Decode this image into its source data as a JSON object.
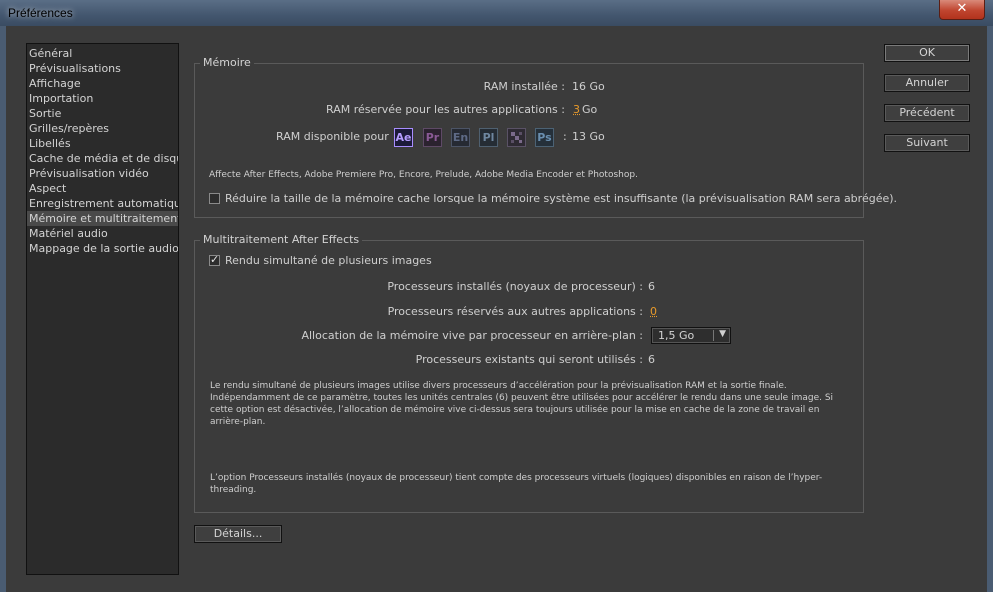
{
  "window": {
    "title": "Préférences",
    "close_symbol": "✕"
  },
  "sidebar": {
    "items": [
      {
        "label": "Général"
      },
      {
        "label": "Prévisualisations"
      },
      {
        "label": "Affichage"
      },
      {
        "label": "Importation"
      },
      {
        "label": "Sortie"
      },
      {
        "label": "Grilles/repères"
      },
      {
        "label": "Libellés"
      },
      {
        "label": "Cache de média et de disque"
      },
      {
        "label": "Prévisualisation vidéo"
      },
      {
        "label": "Aspect"
      },
      {
        "label": "Enregistrement automatique"
      },
      {
        "label": "Mémoire et multitraitement"
      },
      {
        "label": "Matériel audio"
      },
      {
        "label": "Mappage de la sortie audio"
      }
    ],
    "selected": "Mémoire et multitraitement"
  },
  "memory": {
    "legend": "Mémoire",
    "installed_label": "RAM installée :",
    "installed_value": "16 Go",
    "reserved_label": "RAM réservée pour les autres applications :",
    "reserved_value": "3",
    "reserved_unit": "Go",
    "available_label": "RAM disponible pour",
    "available_sep": ":",
    "available_value": "13 Go",
    "apps": [
      {
        "icon": "after-effects-icon",
        "text": "Ae",
        "color": "#b59cff",
        "bg": "#1c1a3a",
        "border": "#a88dff"
      },
      {
        "icon": "premiere-pro-icon",
        "text": "Pr",
        "color": "#8a5a96",
        "bg": "#2b222f",
        "border": "#5e4a66"
      },
      {
        "icon": "encore-icon",
        "text": "En",
        "color": "#5e6a86",
        "bg": "#262a33",
        "border": "#4c5466"
      },
      {
        "icon": "prelude-icon",
        "text": "Pl",
        "color": "#6f87a0",
        "bg": "#252c34",
        "border": "#4f6070"
      },
      {
        "icon": "media-encoder-icon",
        "text": "",
        "color": "#7a6a8a",
        "bg": "#2e2a33",
        "border": "#5a5266"
      },
      {
        "icon": "photoshop-icon",
        "text": "Ps",
        "color": "#6a8fb0",
        "bg": "#25303a",
        "border": "#4c6274"
      }
    ],
    "affects_note": "Affecte After Effects, Adobe Premiere Pro, Encore, Prelude, Adobe Media Encoder et Photoshop.",
    "reduce_cache_label": "Réduire la taille de la mémoire cache lorsque la mémoire système est insuffisante (la prévisualisation RAM sera abrégée).",
    "reduce_cache_checked": false
  },
  "multi": {
    "legend": "Multitraitement After Effects",
    "render_multiple_label": "Rendu simultané de plusieurs images",
    "render_multiple_checked": true,
    "installed_cpu_label": "Processeurs installés (noyaux de processeur) :",
    "installed_cpu_value": "6",
    "reserved_cpu_label": "Processeurs réservés aux autres applications :",
    "reserved_cpu_value": "0",
    "alloc_label": "Allocation de la mémoire vive par processeur en arrière-plan :",
    "alloc_value": "1,5 Go",
    "used_cpu_label": "Processeurs existants qui seront utilisés :",
    "used_cpu_value": "6",
    "desc_line1": "Le rendu simultané de plusieurs images utilise divers processeurs d’accélération pour la prévisualisation RAM et la sortie finale.",
    "desc_line2": "Indépendamment de ce paramètre, toutes les unités centrales (6) peuvent être utilisées pour accélérer le rendu dans une seule image. Si",
    "desc_line3": "cette option est désactivée, l’allocation de mémoire vive ci-dessus sera toujours utilisée pour la mise en cache de la zone de travail en",
    "desc_line4": "arrière-plan.",
    "note_line1": "L’option Processeurs installés (noyaux de processeur) tient compte des processeurs virtuels (logiques) disponibles en raison de l’hyper-",
    "note_line2": "threading."
  },
  "buttons": {
    "ok": "OK",
    "cancel": "Annuler",
    "previous": "Précédent",
    "next": "Suivant",
    "details": "Détails..."
  }
}
